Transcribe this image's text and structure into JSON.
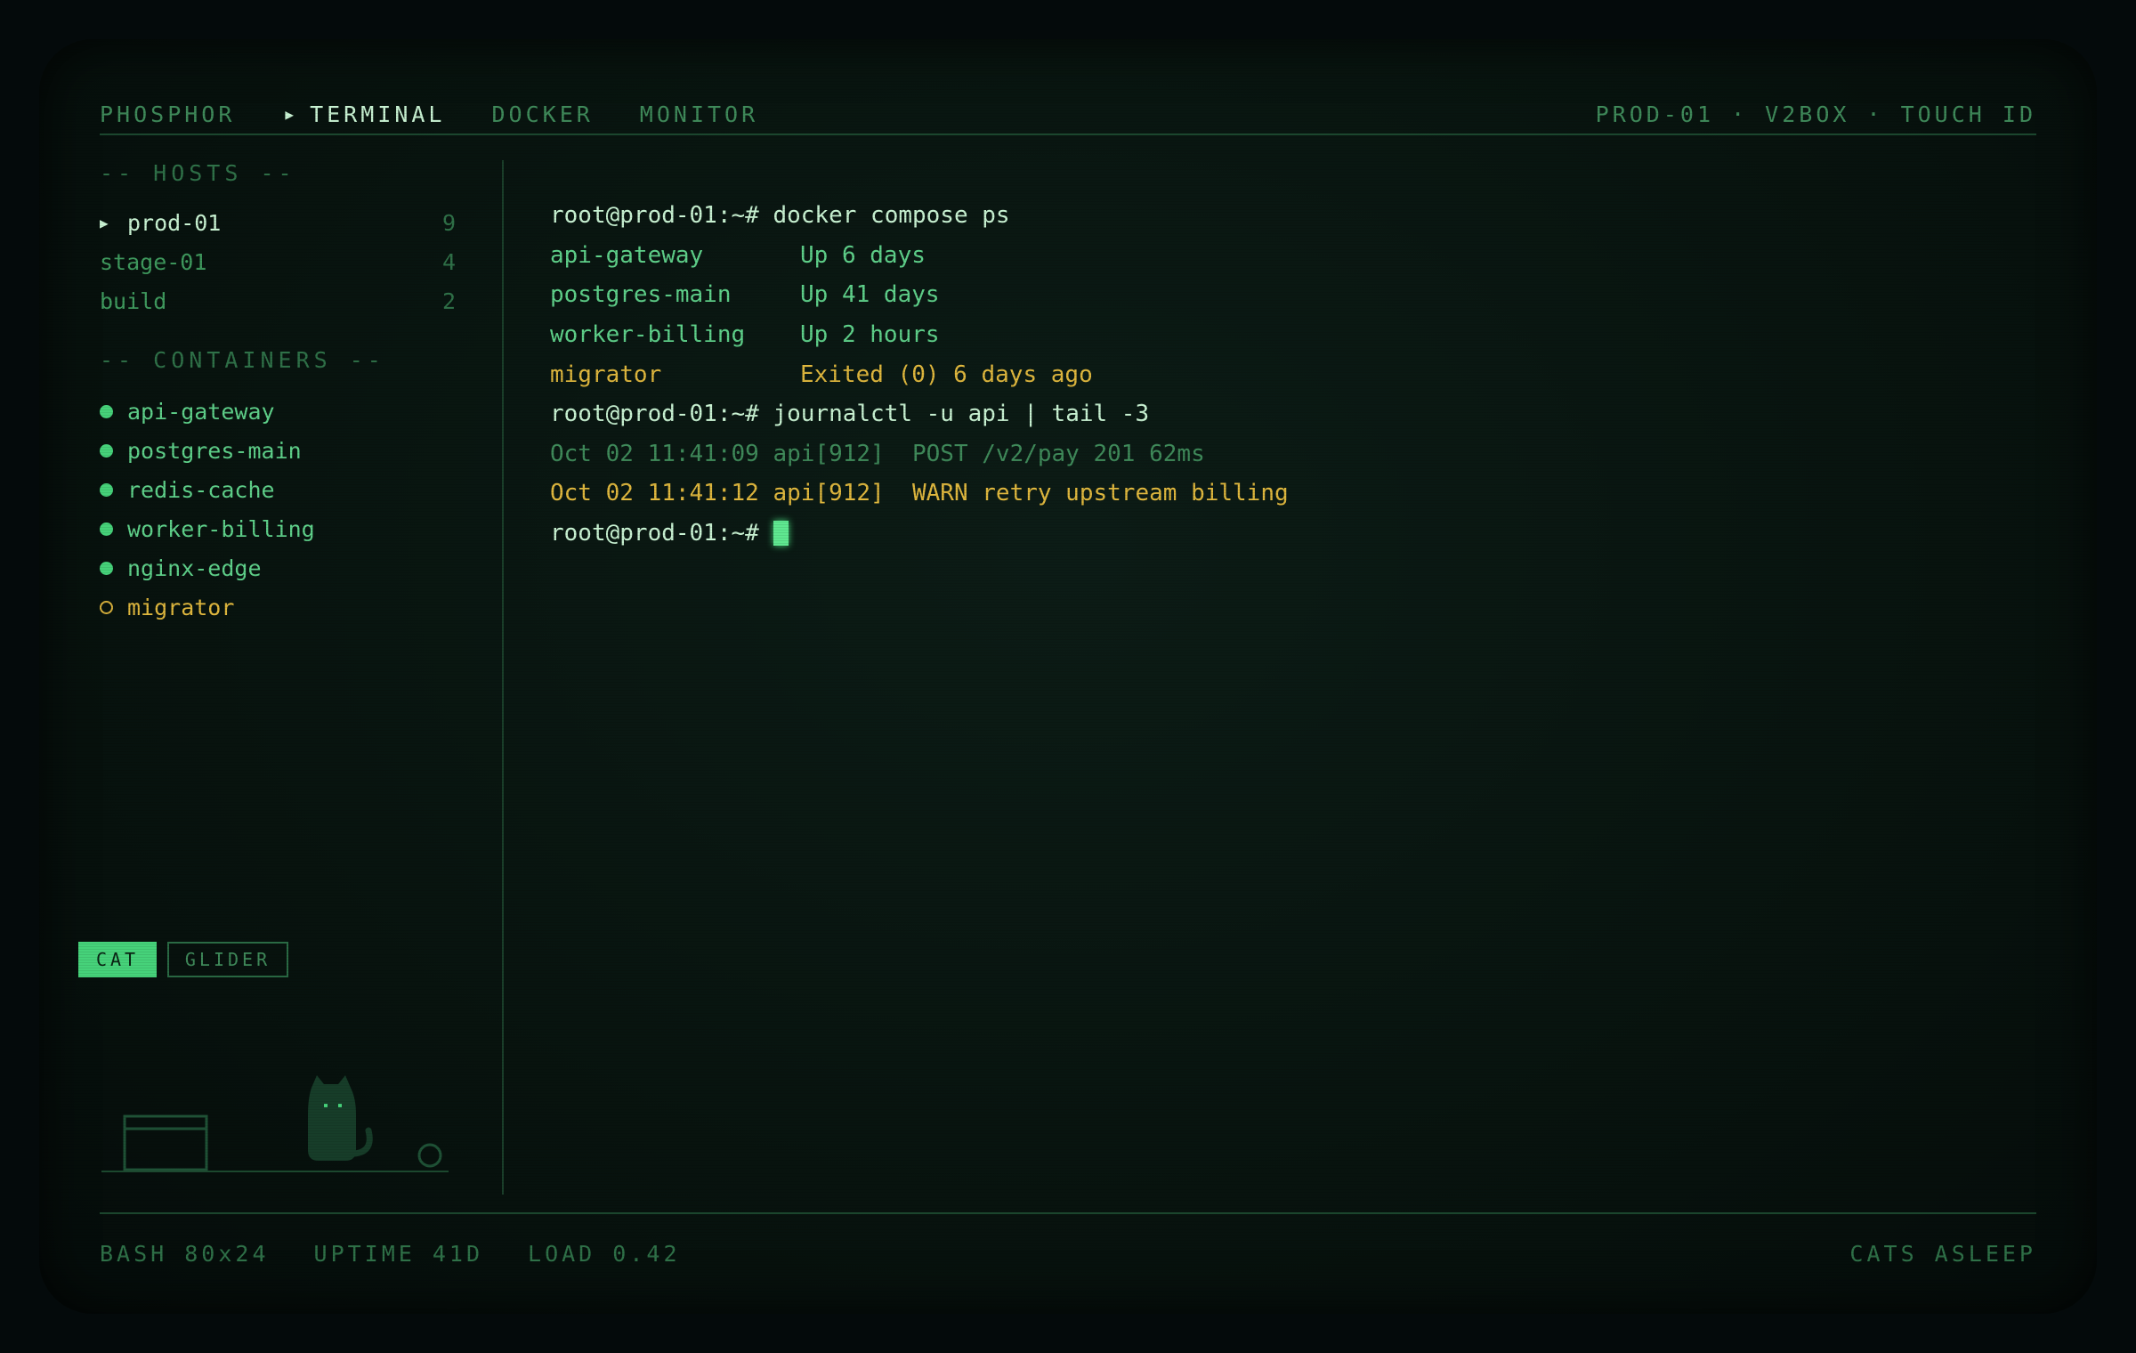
{
  "topbar": {
    "brand": "PHOSPHOR",
    "tabs": [
      {
        "label": "TERMINAL",
        "active": true
      },
      {
        "label": "DOCKER",
        "active": false
      },
      {
        "label": "MONITOR",
        "active": false
      }
    ],
    "right_info": "PROD-01 · V2BOX · TOUCH ID"
  },
  "sidebar": {
    "hosts_title": "-- HOSTS --",
    "hosts": [
      {
        "name": "prod-01",
        "count": "9",
        "active": true
      },
      {
        "name": "stage-01",
        "count": "4",
        "active": false
      },
      {
        "name": "build",
        "count": "2",
        "active": false
      }
    ],
    "containers_title": "-- CONTAINERS --",
    "containers": [
      {
        "name": "api-gateway",
        "running": true
      },
      {
        "name": "postgres-main",
        "running": true
      },
      {
        "name": "redis-cache",
        "running": true
      },
      {
        "name": "worker-billing",
        "running": true
      },
      {
        "name": "nginx-edge",
        "running": true
      },
      {
        "name": "migrator",
        "running": false
      }
    ],
    "toggle": {
      "cat": "CAT",
      "glider": "GLIDER",
      "selected": "CAT"
    }
  },
  "terminal": {
    "prompt": "root@prod-01:~#",
    "cmd1": "docker compose ps",
    "ps_rows": [
      {
        "name": "api-gateway",
        "status": "Up 6 days"
      },
      {
        "name": "postgres-main",
        "status": "Up 41 days"
      },
      {
        "name": "worker-billing",
        "status": "Up 2 hours"
      },
      {
        "name": "migrator",
        "status": "Exited (0) 6 days ago"
      }
    ],
    "cmd2": "journalctl -u api | tail -3",
    "log1_prefix": "Oct 02 11:41:09 api[912]",
    "log1_msg": "POST /v2/pay 201 62ms",
    "log2_prefix": "Oct 02 11:41:12 api[912]",
    "log2_msg": "WARN retry upstream billing"
  },
  "status": {
    "shell": "BASH 80x24",
    "uptime": "UPTIME 41D",
    "load": "LOAD 0.42",
    "right": "CATS ASLEEP"
  },
  "colors": {
    "background": "#08140f",
    "phosphor": "#46d27a",
    "bright": "#c9f3d3",
    "amber": "#e0b83e",
    "dim": "#3f8a5a"
  },
  "icons": [
    "caret-right-icon",
    "status-dot-icon",
    "cat-icon",
    "box-icon",
    "ball-icon",
    "cursor-block-icon"
  ]
}
